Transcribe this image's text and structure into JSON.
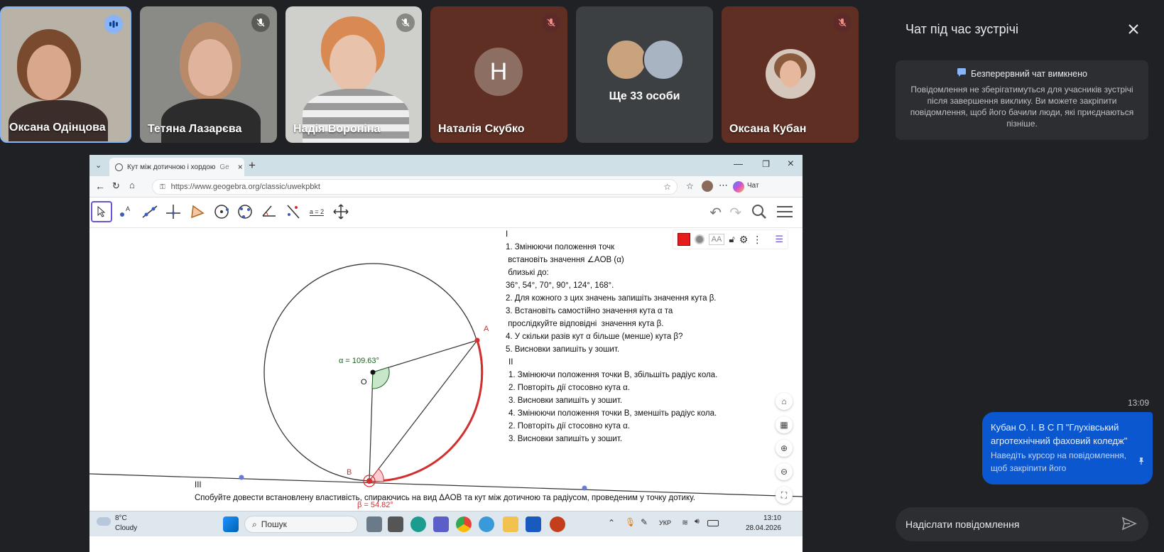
{
  "participants": [
    {
      "name": "Оксана Одінцова",
      "mic": "speaking"
    },
    {
      "name": "Тетяна Лазарєва",
      "mic": "muted"
    },
    {
      "name": "Надія Вороніна",
      "mic": "muted"
    },
    {
      "name": "Наталія Скубко",
      "mic": "muted",
      "avatar_letter": "Н"
    },
    {
      "name": "Ще 33 особи",
      "mic": "none"
    },
    {
      "name": "Оксана Кубан",
      "mic": "muted"
    }
  ],
  "browser": {
    "tab_title": "Кут між дотичною і хордою",
    "tab_suffix": "Ge",
    "url": "https://www.geogebra.org/classic/uwekpbkt",
    "copilot_label": "Чат"
  },
  "ggb": {
    "tools_eq_label": "a = 2",
    "alpha_label": "α = 109.63°",
    "beta_label": "β = 54.82°",
    "point_o": "O",
    "point_a": "A",
    "point_b": "B",
    "section1_lines": [
      "I",
      "1. Змінюючи положення точк",
      " встановіть значення ∠AOB (α)",
      " близькі до:",
      "36°, 54°, 70°, 90°, 124°, 168°.",
      "2. Для кожного з цих значень запишіть значення кута β.",
      "3. Встановіть самостійно значення кута α та",
      " прослідкуйте відповідні  значення кута β.",
      "4. У скільки разів кут α більше (менше) кута β?",
      "5. Висновки запишіть у зошит."
    ],
    "section2_lines": [
      "II",
      "1. Змінюючи положення точки В, збільшіть радіус кола.",
      "2. Повторіть дії стосовно кута α.",
      "3. Висновки запишіть у зошит.",
      "4. Змінюючи положення точки В, зменшіть радіус кола.",
      "2. Повторіть дії стосовно кута α.",
      "3. Висновки запишіть у зошит."
    ],
    "section3_title": "III",
    "section3_text": "Спобуйте довести встановлену властивість, спираючись на вид ΔAOB та кут між дотичною та радіусом, проведеним у точку дотику.",
    "colors": {
      "accent": "#6557d2",
      "red": "#d32f2f",
      "green": "#1b5e20"
    }
  },
  "taskbar": {
    "weather_temp": "8°C",
    "weather_text": "Cloudy",
    "search_label": "Пошук",
    "lang": "УКР",
    "time": "13:10",
    "date": "28.04.2026"
  },
  "chat": {
    "title": "Чат під час зустрічі",
    "notice_title": "Безперервний чат вимкнено",
    "notice_body": "Повідомлення не зберігатимуться для учасників зустрічі після завершення виклику. Ви можете закріпити повідомлення, щоб його бачили люди, які приєднаються пізніше.",
    "message_time": "13:09",
    "message_text": "Кубан О. І.   В С П   \"Глухівський агротехнічний фаховий коледж\"",
    "message_hint": "Наведіть курсор на повідомлення, щоб закріпити його",
    "input_placeholder": "Надіслати повідомлення",
    "colors": {
      "bubble": "#0b57d0",
      "panel": "#202124"
    }
  }
}
